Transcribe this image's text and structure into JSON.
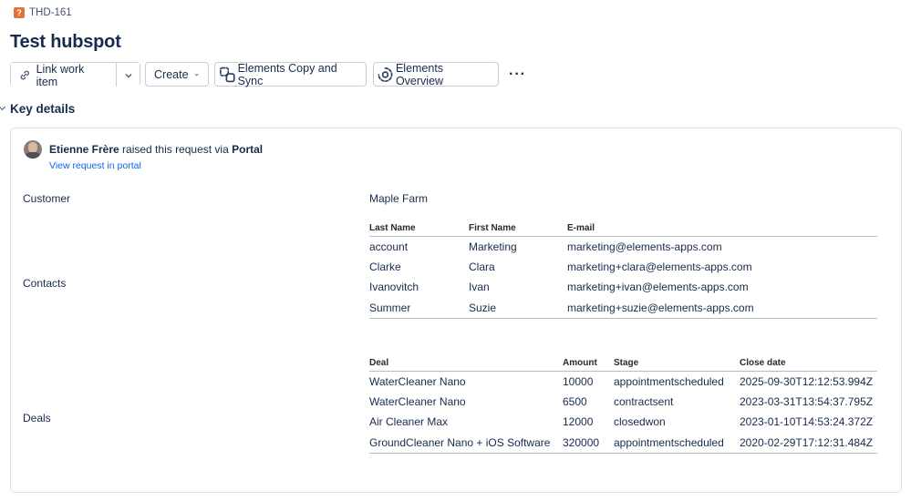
{
  "issue": {
    "key": "THD-161",
    "type_icon": "question-icon",
    "title": "Test hubspot"
  },
  "toolbar": {
    "link_work_item": "Link work item",
    "create": "Create",
    "elements_copy_sync": "Elements Copy and Sync",
    "elements_overview": "Elements Overview",
    "more": "···"
  },
  "key_details": {
    "title": "Key details",
    "requester": {
      "name": "Etienne Frère",
      "action": " raised this request via ",
      "channel": "Portal",
      "link": "View request in portal"
    },
    "customer": {
      "label": "Customer",
      "value": "Maple Farm"
    },
    "contacts": {
      "label": "Contacts",
      "columns": [
        "Last Name",
        "First Name",
        "E-mail"
      ],
      "rows": [
        [
          "account",
          "Marketing",
          "marketing@elements-apps.com"
        ],
        [
          "Clarke",
          "Clara",
          "marketing+clara@elements-apps.com"
        ],
        [
          "Ivanovitch",
          "Ivan",
          "marketing+ivan@elements-apps.com"
        ],
        [
          "Summer",
          "Suzie",
          "marketing+suzie@elements-apps.com"
        ]
      ]
    },
    "deals": {
      "label": "Deals",
      "columns": [
        "Deal",
        "Amount",
        "Stage",
        "Close date"
      ],
      "rows": [
        [
          "WaterCleaner Nano",
          "10000",
          "appointmentscheduled",
          "2025-09-30T12:12:53.994Z"
        ],
        [
          "WaterCleaner Nano",
          "6500",
          "contractsent",
          "2023-03-31T13:54:37.795Z"
        ],
        [
          "Air Cleaner Max",
          "12000",
          "closedwon",
          "2023-01-10T14:53:24.372Z"
        ],
        [
          "GroundCleaner Nano + iOS Software",
          "320000",
          "appointmentscheduled",
          "2020-02-29T17:12:31.484Z"
        ]
      ]
    }
  },
  "colors": {
    "link": "#0c66e4",
    "issue_type": "#e2733d",
    "text": "#172b4d"
  }
}
